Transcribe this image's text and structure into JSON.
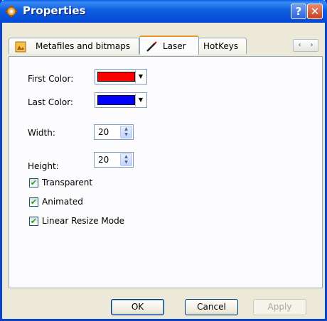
{
  "window": {
    "title": "Properties"
  },
  "titlebar": {
    "help_label": "?",
    "close_label": "✕"
  },
  "tabs": [
    {
      "label": "Metafiles and bitmaps",
      "icon": "image-folder-icon",
      "active": false
    },
    {
      "label": "Laser",
      "icon": "laser-pen-icon",
      "active": true
    },
    {
      "label": "HotKeys",
      "active": false
    }
  ],
  "tab_scroll": {
    "left": "‹",
    "right": "›"
  },
  "laser": {
    "first_color_label": "First Color:",
    "first_color": "#ff0000",
    "last_color_label": "Last Color:",
    "last_color": "#0000ff",
    "width_label": "Width:",
    "width_value": "20",
    "height_label": "Height:",
    "height_value": "20",
    "options": [
      {
        "label": "Transparent",
        "checked": true
      },
      {
        "label": "Animated",
        "checked": true
      },
      {
        "label": "Linear Resize Mode",
        "checked": true
      }
    ]
  },
  "buttons": {
    "ok": "OK",
    "cancel": "Cancel",
    "apply": "Apply"
  },
  "colors": {
    "titlebar": "#0a5ce8",
    "active_tab_accent": "#e59a2b",
    "checkmark": "#21a121"
  }
}
